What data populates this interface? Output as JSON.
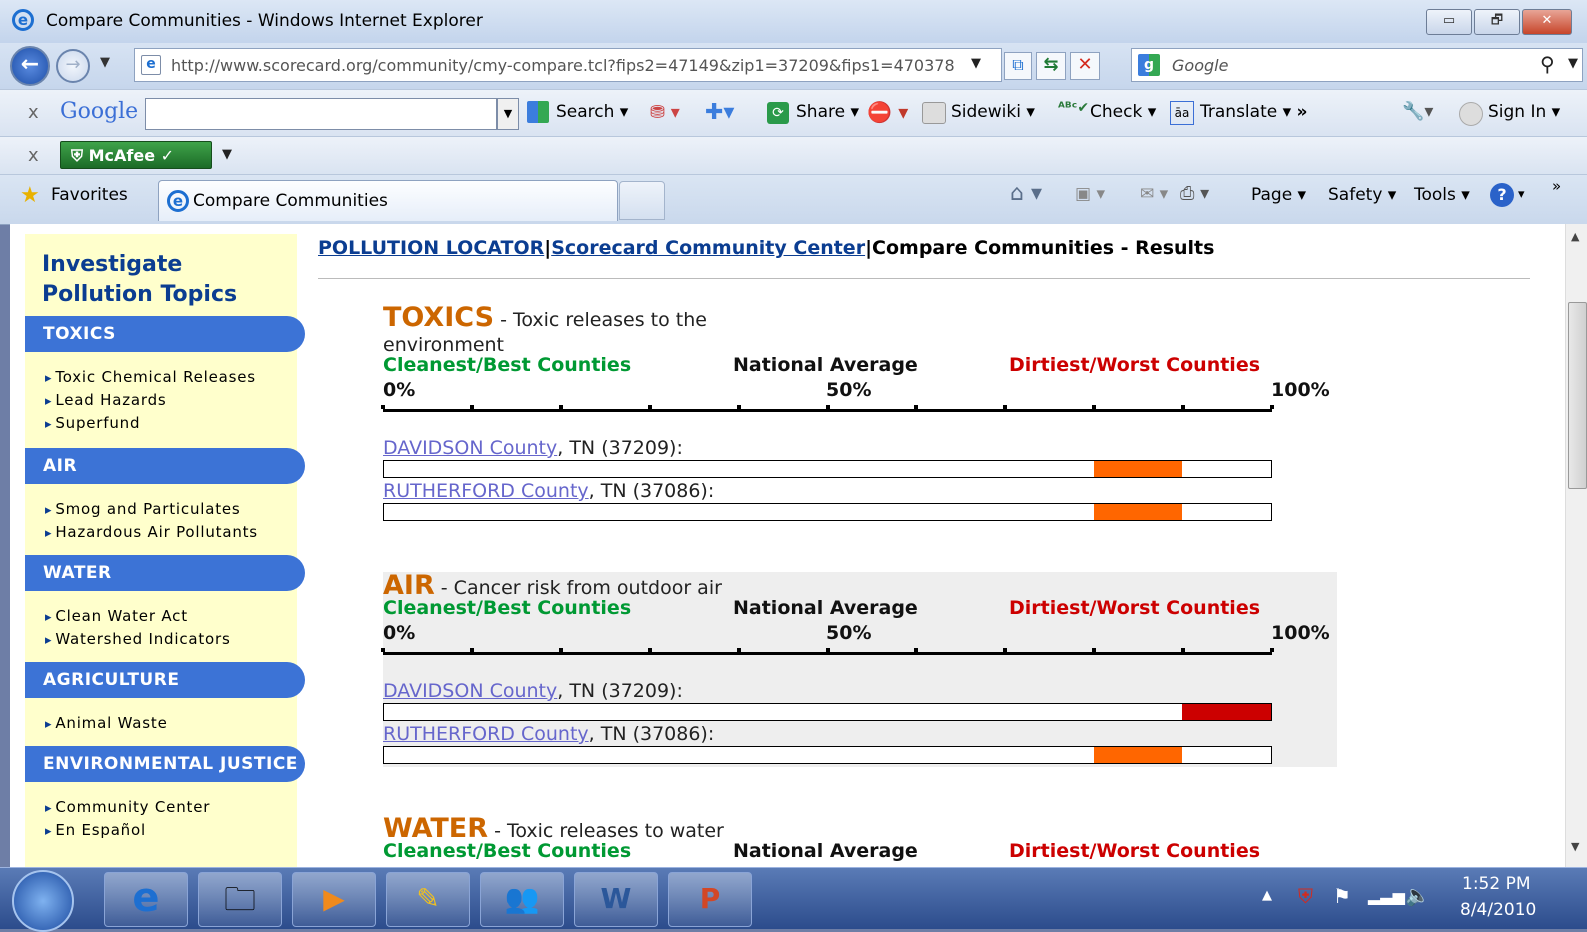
{
  "window": {
    "title": "Compare Communities - Windows Internet Explorer",
    "min": "▭",
    "max": "🗗",
    "close": "✕"
  },
  "address": {
    "url": "http://www.scorecard.org/community/cmy-compare.tcl?fips2=47149&zip1=37209&fips1=470378",
    "search_placeholder": "Google"
  },
  "google_toolbar": {
    "brand": "Google",
    "search": "Search",
    "share": "Share",
    "sidewiki": "Sidewiki",
    "check": "Check",
    "translate": "Translate",
    "signin": "Sign In"
  },
  "mcafee": {
    "label": "McAfee"
  },
  "favbar": {
    "favorites": "Favorites",
    "tab_title": "Compare Communities",
    "page": "Page",
    "safety": "Safety",
    "tools": "Tools"
  },
  "sidebar": {
    "heading1": "Investigate",
    "heading2": "Pollution Topics",
    "cats": [
      {
        "label": "TOXICS",
        "links": [
          "Toxic Chemical Releases",
          "Lead Hazards",
          "Superfund"
        ]
      },
      {
        "label": "AIR",
        "links": [
          "Smog and Particulates",
          "Hazardous Air Pollutants"
        ]
      },
      {
        "label": "WATER",
        "links": [
          "Clean Water Act",
          "Watershed Indicators"
        ]
      },
      {
        "label": "AGRICULTURE",
        "links": [
          "Animal Waste"
        ]
      },
      {
        "label": "ENVIRONMENTAL JUSTICE",
        "links": [
          "Community Center",
          "En Español"
        ]
      }
    ]
  },
  "breadcrumb": {
    "link1": "POLLUTION LOCATOR",
    "sep": "|",
    "link2": "Scorecard Community Center",
    "current": "Compare Communities - Results"
  },
  "scale": {
    "left": "Cleanest/Best Counties",
    "mid": "National Average",
    "right": "Dirtiest/Worst Counties",
    "p0": "0%",
    "p50": "50%",
    "p100": "100%"
  },
  "sections": [
    {
      "title": "TOXICS",
      "dash": " - ",
      "desc": "Toxic releases to the",
      "desc2": "environment",
      "rows": [
        {
          "county": "DAVIDSON County",
          "rest": ", TN (37209):",
          "fill_from": 0.8,
          "fill_to": 0.9,
          "color": "#ff6600"
        },
        {
          "county": "RUTHERFORD County",
          "rest": ", TN (37086):",
          "fill_from": 0.8,
          "fill_to": 0.9,
          "color": "#ff6600"
        }
      ]
    },
    {
      "title": "AIR",
      "dash": " - ",
      "desc": "Cancer risk from outdoor air",
      "rows": [
        {
          "county": "DAVIDSON County",
          "rest": ", TN (37209):",
          "fill_from": 0.9,
          "fill_to": 1.0,
          "color": "#cc0000"
        },
        {
          "county": "RUTHERFORD County",
          "rest": ", TN (37086):",
          "fill_from": 0.8,
          "fill_to": 0.9,
          "color": "#ff6600"
        }
      ]
    },
    {
      "title": "WATER",
      "dash": " - ",
      "desc": "Toxic releases to water"
    }
  ],
  "taskbar": {
    "time": "1:52 PM",
    "date": "8/4/2010"
  }
}
